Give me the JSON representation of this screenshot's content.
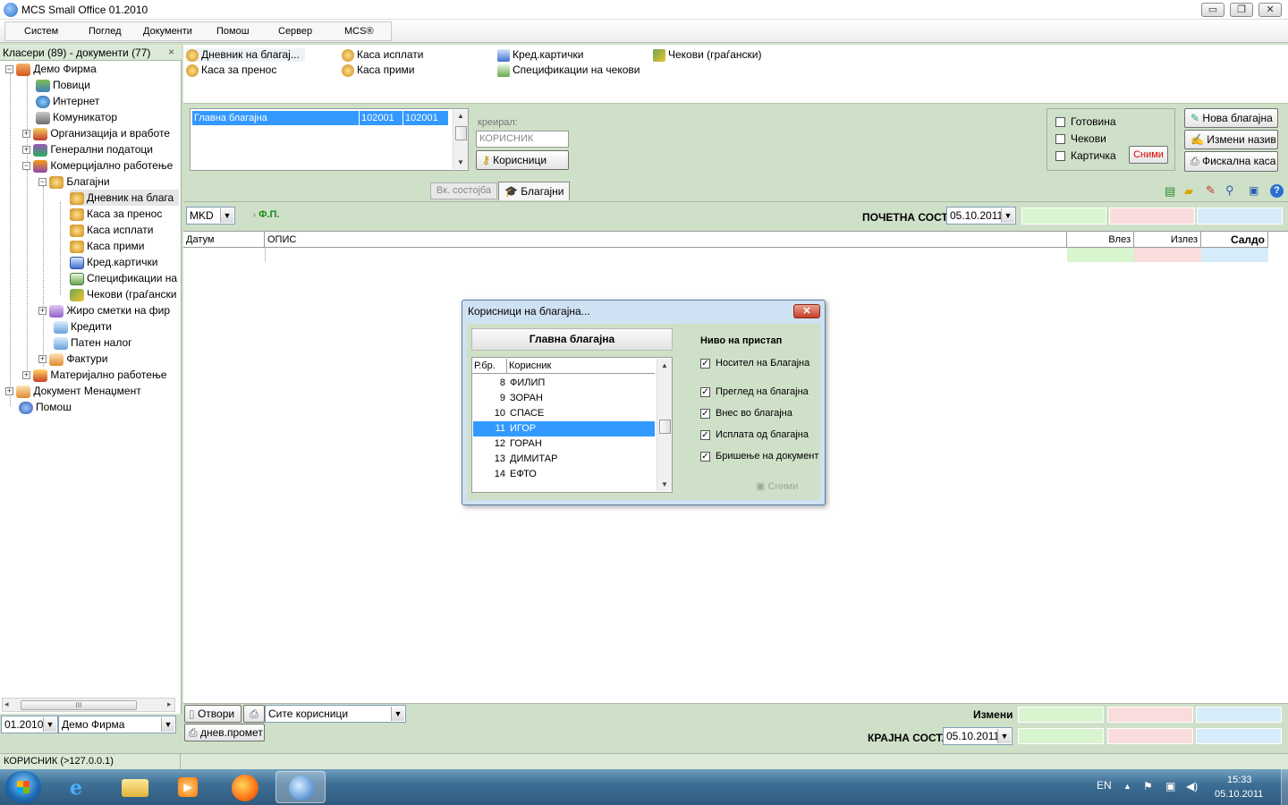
{
  "app": {
    "title": "MCS Small Office 01.2010",
    "window_controls": {
      "minimize": "▭",
      "restore": "❐",
      "close": "✕"
    }
  },
  "menu": [
    "Систем",
    "Поглед",
    "Документи",
    "Помош",
    "Сервер",
    "MCS®"
  ],
  "left_panel": {
    "header": "Класери (89) - документи (77)",
    "close": "×",
    "tree": [
      {
        "label": "Демо Фирма",
        "icon": "house-icon",
        "expander": "−"
      },
      {
        "label": "Повици",
        "icon": "people-icon"
      },
      {
        "label": "Интернет",
        "icon": "globe-icon"
      },
      {
        "label": "Комуникатор",
        "icon": "communicator-icon"
      },
      {
        "label": "Организација и вработе",
        "icon": "organization-icon",
        "expander": "+"
      },
      {
        "label": "Генерални податоци",
        "icon": "data-icon",
        "expander": "+"
      },
      {
        "label": "Комерцијално работење",
        "icon": "commerce-icon",
        "expander": "−"
      },
      {
        "label": "Благајни",
        "icon": "cash-icon",
        "expander": "−"
      },
      {
        "label": "Дневник на блага",
        "icon": "cash-icon",
        "selected": true
      },
      {
        "label": "Каса за пренос",
        "icon": "cash-icon"
      },
      {
        "label": "Каса исплати",
        "icon": "cash-icon"
      },
      {
        "label": "Каса прими",
        "icon": "cash-icon"
      },
      {
        "label": "Кред.картички",
        "icon": "card-icon"
      },
      {
        "label": "Спецификации на",
        "icon": "spec-icon"
      },
      {
        "label": "Чекови (граѓански",
        "icon": "check-icon"
      },
      {
        "label": "Жиро сметки на фир",
        "icon": "bank-icon",
        "expander": "+"
      },
      {
        "label": "Кредити",
        "icon": "doc-icon"
      },
      {
        "label": "Патен налог",
        "icon": "doc-icon"
      },
      {
        "label": "Фактури",
        "icon": "book-icon",
        "expander": "+"
      },
      {
        "label": "Материјално работење",
        "icon": "material-icon",
        "expander": "+"
      },
      {
        "label": "Документ Менаџмент",
        "icon": "book-icon",
        "expander": "+"
      },
      {
        "label": "Помош",
        "icon": "help-icon"
      }
    ],
    "period": "01.2010",
    "company": "Демо Фирма"
  },
  "status_bar": {
    "user": "КОРИСНИК (>127.0.0.1)"
  },
  "shortcuts": [
    {
      "label": "Дневник на благај...",
      "icon": "cash-icon"
    },
    {
      "label": "Каса за пренос",
      "icon": "cash-icon"
    },
    {
      "label": "Каса исплати",
      "icon": "cash-icon"
    },
    {
      "label": "Каса прими",
      "icon": "cash-icon"
    },
    {
      "label": "Кред.картички",
      "icon": "card-icon"
    },
    {
      "label": "Спецификации на чекови",
      "icon": "spec-icon"
    },
    {
      "label": "Чекови (граѓански)",
      "icon": "check-icon"
    }
  ],
  "cashbox_list": {
    "rows": [
      {
        "name": "Главна благајна",
        "code1": "102001",
        "code2": "102001"
      }
    ]
  },
  "creator": {
    "label": "креирал:",
    "value": "КОРИСНИК",
    "users_button": "Корисници"
  },
  "filters": {
    "items": [
      "Готовина",
      "Чекови",
      "Картичка"
    ],
    "save_button": "Сними"
  },
  "actions": {
    "new": "Нова благајна",
    "rename": "Измени назив",
    "fiscal": "Фискална каса"
  },
  "tabs": [
    {
      "label": "Вк. состојба",
      "active": false
    },
    {
      "label": "Благајни",
      "active": true
    }
  ],
  "currency": "MKD",
  "fp_label": "Ф.П.",
  "opening": {
    "label": "ПОЧЕТНА СОСТ.",
    "date": "05.10.2011"
  },
  "grid": {
    "columns": [
      "Датум",
      "ОПИС",
      "Влез",
      "Излез",
      "Салдо"
    ]
  },
  "bottom": {
    "open_button": "Отвори",
    "users_filter": "Сите корисници",
    "daily_button": "днев.промет",
    "change_label": "Измени",
    "closing_label": "КРАЈНА СОСТ.",
    "closing_date": "05.10.2011"
  },
  "dialog": {
    "title": "Корисници на благајна...",
    "close": "✕",
    "cashbox_name": "Главна благајна",
    "columns": [
      "Р.бр.",
      "Корисник"
    ],
    "users": [
      {
        "no": "8",
        "name": "ФИЛИП"
      },
      {
        "no": "9",
        "name": "ЗОРАН"
      },
      {
        "no": "10",
        "name": "СПАСЕ"
      },
      {
        "no": "11",
        "name": "ИГОР",
        "selected": true
      },
      {
        "no": "12",
        "name": "ГОРАН"
      },
      {
        "no": "13",
        "name": "ДИМИТАР"
      },
      {
        "no": "14",
        "name": "ЕФТО"
      }
    ],
    "access_title": "Ниво на пристап",
    "permissions": [
      {
        "label": "Носител на Благајна",
        "checked": true
      },
      {
        "label": "Преглед на благајна",
        "checked": true
      },
      {
        "label": "Внес во благајна",
        "checked": true
      },
      {
        "label": "Исплата од благајна",
        "checked": true
      },
      {
        "label": "Бришење на документ",
        "checked": true
      }
    ],
    "save": "Сними"
  },
  "taskbar": {
    "lang": "EN",
    "time": "15:33",
    "date": "05.10.2011"
  },
  "colors": {
    "panel_green": "#cfe0c8",
    "in_green": "#d8f5d0",
    "out_red": "#fadcdc",
    "saldo_blue": "#d6ecfa",
    "selection": "#3399ff"
  }
}
